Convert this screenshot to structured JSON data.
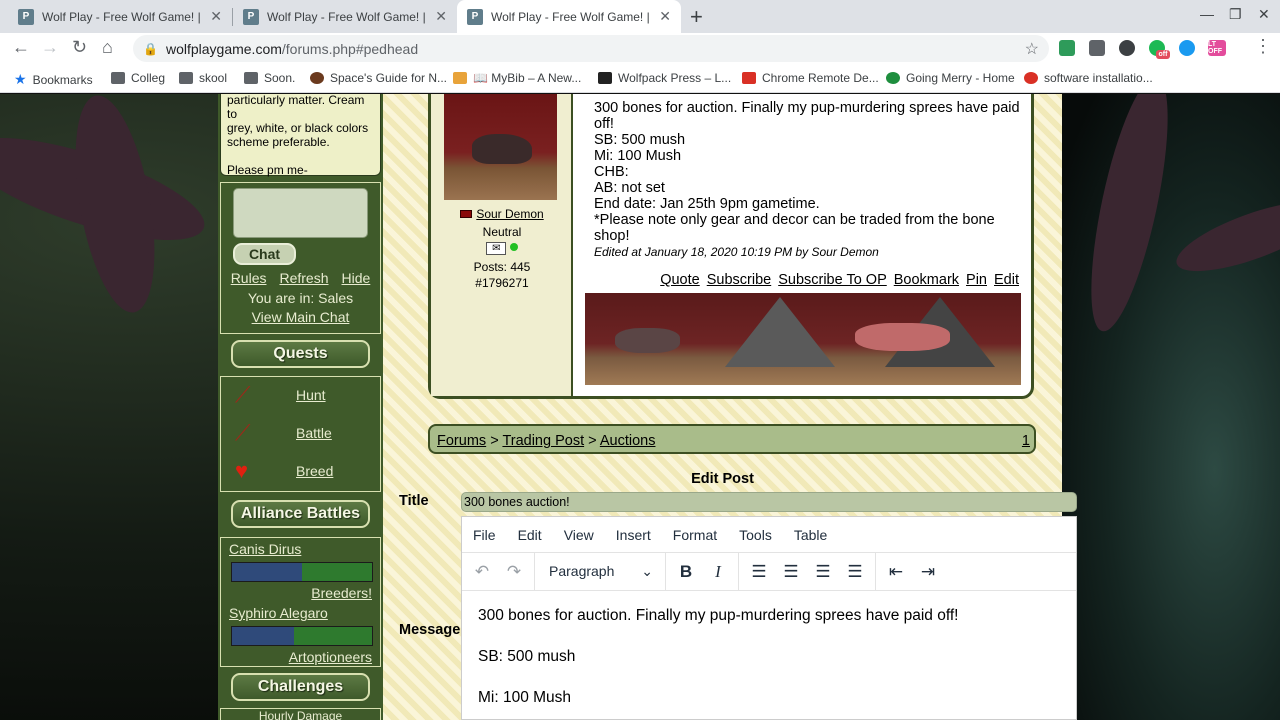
{
  "browser": {
    "tabs": [
      {
        "title": "Wolf Play - Free Wolf Game! | Wo"
      },
      {
        "title": "Wolf Play - Free Wolf Game! | Wo"
      },
      {
        "title": "Wolf Play - Free Wolf Game! | Wo"
      }
    ],
    "favicon_letter": "P",
    "url_host": "wolfplaygame.com",
    "url_path": "/forums.php#pedhead",
    "extensions": [
      {
        "label": "off",
        "color": "#e34c5c"
      },
      {
        "label": "LT OFF",
        "color": "#e34c9c"
      }
    ],
    "bookmarks": [
      "Bookmarks",
      "Colleg",
      "skool",
      "Soon.",
      "Space's Guide for N...",
      "📖 MyBib – A New...",
      "Wolfpack Press – L...",
      "Chrome Remote De...",
      "Going Merry - Home",
      "software installatio..."
    ]
  },
  "sidebar": {
    "message_text": [
      "particularly matter. Cream to",
      "grey, white, or black colors",
      "scheme preferable."
    ],
    "message_footer": "Please pm me-",
    "chat_button": "Chat",
    "chat_links": [
      "Rules",
      "Refresh",
      "Hide"
    ],
    "chat_location": "You are in: Sales",
    "view_main_chat": "View Main Chat",
    "quests_title": "Quests",
    "quests": [
      {
        "label": "Hunt",
        "icon": "claw-icon"
      },
      {
        "label": "Battle",
        "icon": "claw-icon"
      },
      {
        "label": "Breed",
        "icon": "heart-icon"
      }
    ],
    "alliance_title": "Alliance Battles",
    "alliances": [
      {
        "name": "Canis Dirus",
        "opponent": "Breeders!",
        "blue_share": 0.5
      },
      {
        "name": "Syphiro Alegaro",
        "opponent": "Artoptioneers",
        "blue_share": 0.44
      }
    ],
    "challenges_title": "Challenges",
    "challenges_next": "Hourly Damage"
  },
  "post": {
    "author": "Sour Demon",
    "alignment": "Neutral",
    "posts": "Posts: 445",
    "post_id": "#1796271",
    "lines": [
      "300 bones for auction. Finally my pup-murdering sprees have paid off!",
      "SB: 500 mush",
      "Mi: 100 Mush",
      "CHB:",
      "AB: not set",
      "End date: Jan 25th 9pm gametime.",
      "*Please note only gear and decor can be traded from the bone shop!"
    ],
    "edited": "Edited at January 18, 2020 10:19 PM by Sour Demon",
    "actions": [
      "Quote",
      "Subscribe",
      "Subscribe To OP",
      "Bookmark",
      "Pin",
      "Edit"
    ]
  },
  "breadcrumb": {
    "items": [
      "Forums",
      "Trading Post",
      "Auctions"
    ],
    "separator": ">",
    "page": "1"
  },
  "edit_form": {
    "heading": "Edit Post",
    "title_label": "Title",
    "title_value": "300 bones auction!",
    "message_label": "Message",
    "menu": [
      "File",
      "Edit",
      "View",
      "Insert",
      "Format",
      "Tools",
      "Table"
    ],
    "block_format": "Paragraph",
    "body_lines": [
      "300 bones for auction. Finally my pup-murdering sprees have paid off!",
      "SB: 500 mush",
      "Mi: 100 Mush"
    ]
  }
}
